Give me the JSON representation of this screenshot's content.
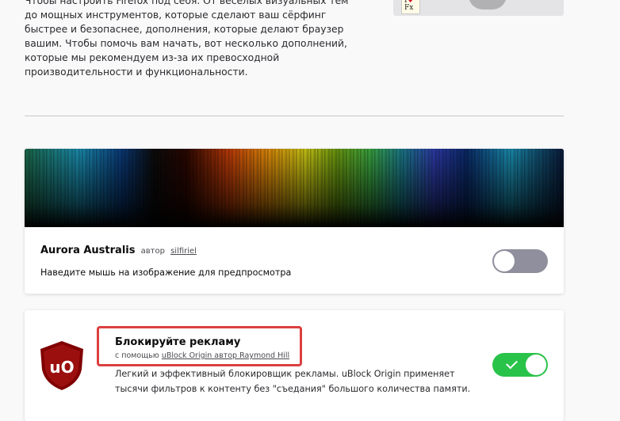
{
  "intro": {
    "paragraph": "Чтобы настроить Firefox под себя. От веселых визуальных тем до мощных инструментов, которые сделают ваш сёрфинг быстрее и безопаснее, дополнения, которые делают браузер вашим. Чтобы помочь вам начать, вот несколько дополнений, которые мы рекомендуем из-за их превосходной производительности и функциональности.",
    "image_note_line1": "I",
    "image_note_heart": "♥",
    "image_note_line2": "Fx"
  },
  "theme_card": {
    "title": "Aurora Australis",
    "author_prefix": "автор",
    "author": "silfiriel",
    "description": "Наведите мышь на изображение для предпросмотра",
    "enabled": false
  },
  "extension_card": {
    "title": "Блокируйте рекламу",
    "subtitle_prefix": "с помощью",
    "subtitle_link": "uBlock Origin автор Raymond Hill",
    "description": "Легкий и эффективный блокировщик рекламы. uBlock Origin применяет тысячи фильтров к контенту без \"съедания\" большого количества памяти.",
    "icon_text": "uO",
    "enabled": true
  },
  "colors": {
    "accent_green": "#2ac34a",
    "toggle_off": "#8f8f9d",
    "highlight": "#dc3f3f",
    "ublock_red": "#800000"
  }
}
